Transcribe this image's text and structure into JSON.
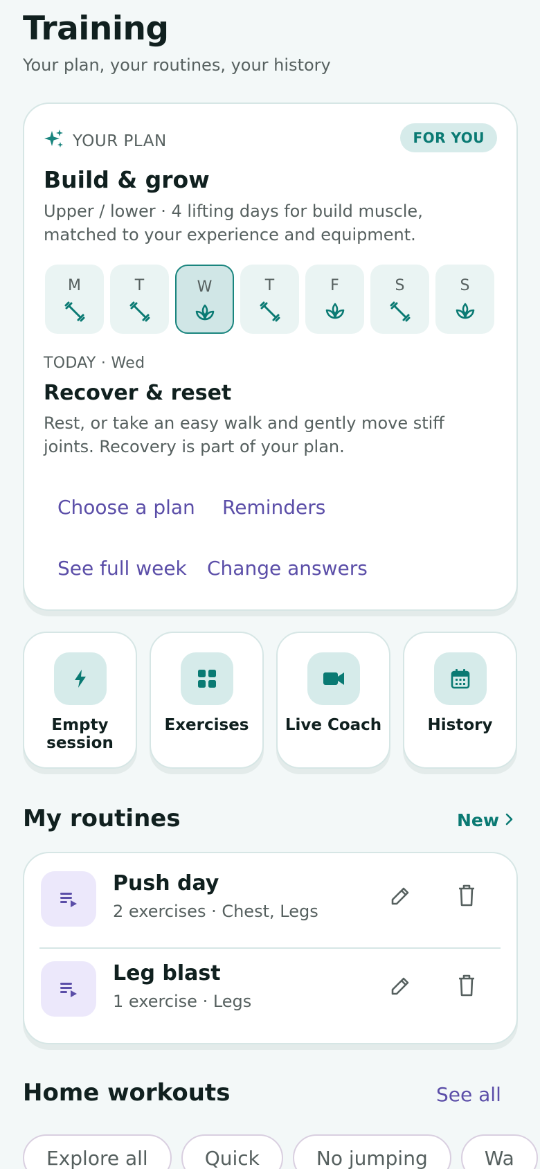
{
  "header": {
    "title": "Training",
    "subtitle": "Your plan, your routines, your history"
  },
  "plan": {
    "label": "YOUR PLAN",
    "badge": "FOR YOU",
    "title": "Build & grow",
    "description": "Upper / lower · 4 lifting days for build muscle, matched to your experience and equipment.",
    "days": [
      {
        "letter": "M",
        "icon": "dumbbell-icon"
      },
      {
        "letter": "T",
        "icon": "dumbbell-icon"
      },
      {
        "letter": "W",
        "icon": "recovery-lotus-icon",
        "active": true
      },
      {
        "letter": "T",
        "icon": "dumbbell-icon"
      },
      {
        "letter": "F",
        "icon": "recovery-lotus-icon"
      },
      {
        "letter": "S",
        "icon": "dumbbell-icon"
      },
      {
        "letter": "S",
        "icon": "recovery-lotus-icon"
      }
    ],
    "today_label": "TODAY · Wed",
    "today_title": "Recover & reset",
    "today_description": "Rest, or take an easy walk and gently move stiff joints. Recovery is part of your plan.",
    "actions": {
      "choose_plan": "Choose a plan",
      "reminders": "Reminders",
      "see_week": "See full week",
      "change_answers": "Change answers"
    }
  },
  "quick_actions": [
    {
      "label": "Empty session",
      "icon": "bolt-icon"
    },
    {
      "label": "Exercises",
      "icon": "grid-icon"
    },
    {
      "label": "Live Coach",
      "icon": "video-camera-icon"
    },
    {
      "label": "History",
      "icon": "calendar-icon"
    }
  ],
  "routines": {
    "title": "My routines",
    "new_label": "New",
    "items": [
      {
        "name": "Push day",
        "meta": "2 exercises · Chest, Legs"
      },
      {
        "name": "Leg blast",
        "meta": "1 exercise · Legs"
      }
    ]
  },
  "home_workouts": {
    "title": "Home workouts",
    "see_all": "See all",
    "chips": [
      "Explore all",
      "Quick",
      "No jumping",
      "Wa"
    ]
  },
  "colors": {
    "background": "#f3f8f8",
    "teal_accent": "#0a7a73",
    "purple_link": "#5b4ea8",
    "icon_tile": "#d6ebea",
    "routine_tile": "#ece8fb"
  }
}
